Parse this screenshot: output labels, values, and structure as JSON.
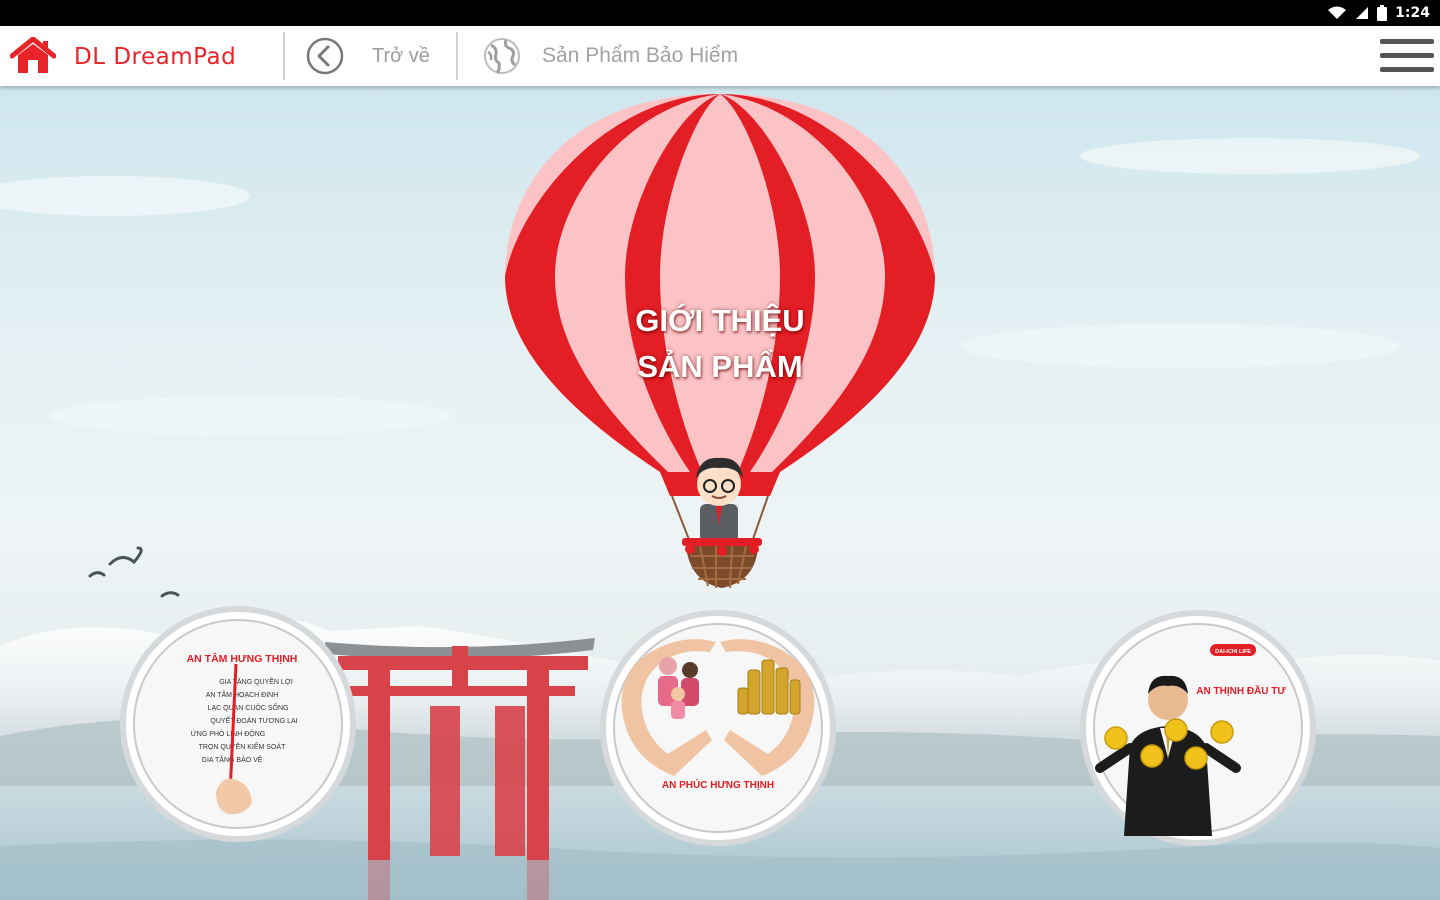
{
  "status_bar": {
    "time": "1:24"
  },
  "app_bar": {
    "brand": "DL DreamPad",
    "back_label": "Trở về",
    "section_label": "Sản Phẩm Bảo Hiểm"
  },
  "balloon": {
    "title_line1": "GIỚI THIỆU",
    "title_line2": "SẢN PHẨM"
  },
  "products": [
    {
      "title": "AN TÂM HƯNG THỊNH",
      "lines": [
        "GIA TĂNG QUYỀN LỢI",
        "AN TÂM HOẠCH ĐỊNH",
        "LẠC QUAN CUỘC SỐNG",
        "QUYẾT ĐOÁN TƯƠNG LAI",
        "ỨNG PHÓ LINH ĐỘNG",
        "TRỌN QUYỀN KIỂM SOÁT",
        "GIA TĂNG BẢO VỆ"
      ]
    },
    {
      "title": "AN PHÚC HƯNG THỊNH"
    },
    {
      "title": "AN THỊNH ĐẦU TƯ",
      "badge": "DAI-ICHI LIFE"
    }
  ],
  "colors": {
    "brand_red": "#e8232a",
    "balloon_red": "#e31e24",
    "balloon_pink": "#fcc3c6"
  }
}
